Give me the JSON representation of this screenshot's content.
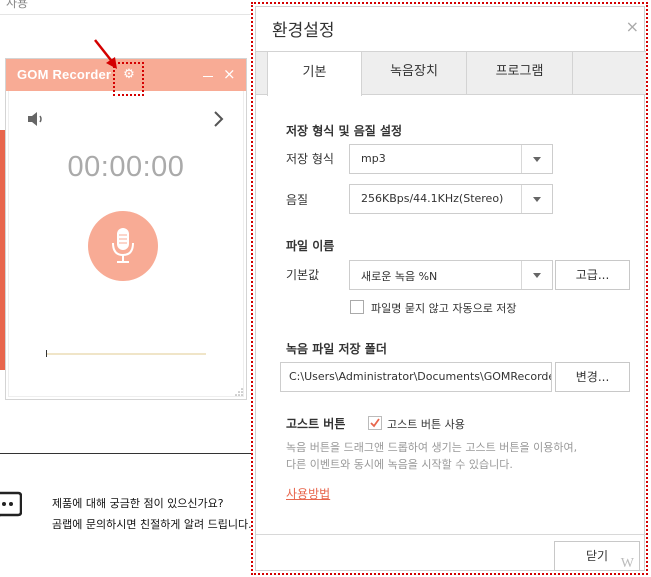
{
  "background": {
    "top_text": "사용",
    "faq_line1": "제품에 대해 궁금한 점이 있으신가요?",
    "faq_line2": "곰랩에 문의하시면 친절하게 알려 드립니다."
  },
  "recorder": {
    "logo": "GOM Recorder",
    "close": "×",
    "timer": "00:00:00",
    "level": 0
  },
  "dialog": {
    "title": "환경설정",
    "close": "×",
    "tabs": [
      {
        "label": "기본",
        "active": true
      },
      {
        "label": "녹음장치",
        "active": false
      },
      {
        "label": "프로그램",
        "active": false
      }
    ],
    "save_format_section": "저장 형식 및 음질 설정",
    "format_label": "저장 형식",
    "format_value": "mp3",
    "quality_label": "음질",
    "quality_value": "256KBps/44.1KHz(Stereo)",
    "filename_section": "파일 이름",
    "default_label": "기본값",
    "default_value": "새로운 녹음 %N",
    "advanced_button": "고급...",
    "auto_save_checkbox": "파일명 묻지 않고 자동으로 저장",
    "auto_save_checked": false,
    "folder_section": "녹음 파일 저장 폴더",
    "folder_path": "C:\\Users\\Administrator\\Documents\\GOMRecorder",
    "change_button": "변경...",
    "ghost_section": "고스트 버튼",
    "ghost_checkbox": "고스트 버튼 사용",
    "ghost_checked": true,
    "ghost_desc_line1": "녹음 버튼을 드래그앤 드롭하여 생기는 고스트 버튼을 이용하여,",
    "ghost_desc_line2": "다른 이벤트와 동시에 녹음을 시작할 수 있습니다.",
    "howto_link": "사용방법",
    "close_button": "닫기"
  },
  "watermark": "W",
  "colors": {
    "accent": "#f8ab95",
    "link": "#e8664d",
    "annotation": "#d40000"
  }
}
